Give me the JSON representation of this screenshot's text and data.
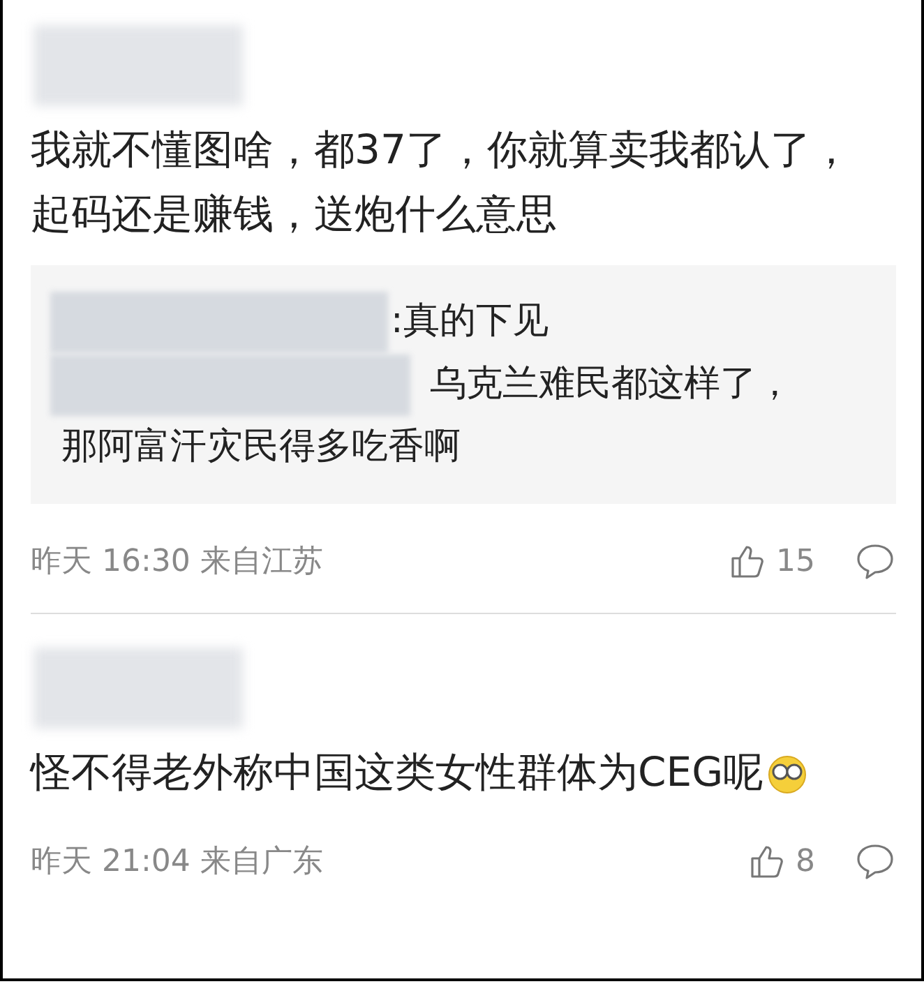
{
  "comments": [
    {
      "text": "我就不懂图啥，都37了，你就算卖我都认了，起码还是赚钱，送炮什么意思",
      "replies": [
        {
          "lines": [
            ":真的下见"
          ]
        },
        {
          "lines": [
            "乌克兰难民都这样了，",
            "那阿富汗灾民得多吃香啊"
          ]
        }
      ],
      "time": "昨天 16:30 来自江苏",
      "likes": "15"
    },
    {
      "text": "怪不得老外称中国这类女性群体为CEG呢",
      "emoji": true,
      "time": "昨天 21:04 来自广东",
      "likes": "8"
    }
  ]
}
